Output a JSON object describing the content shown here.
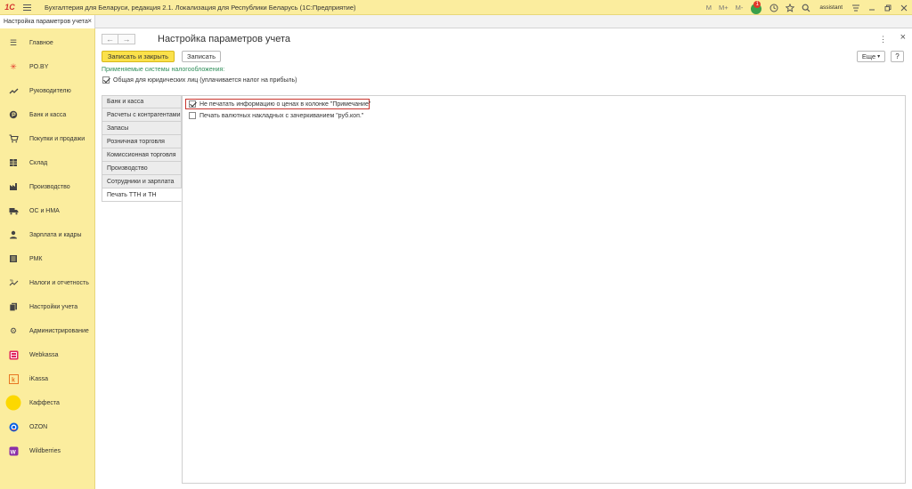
{
  "app": {
    "logo": "1С",
    "title": "Бухгалтерия для Беларуси, редакция 2.1. Локализация для Республики Беларусь  (1С:Предприятие)",
    "toolbar": {
      "m1": "M",
      "m2": "M+",
      "m3": "M-",
      "badge_count": "1",
      "user": "assistant"
    }
  },
  "tab": {
    "label": "Настройка параметров учета"
  },
  "sidebar": {
    "items": [
      {
        "label": "Главное"
      },
      {
        "label": "PO.BY"
      },
      {
        "label": "Руководителю"
      },
      {
        "label": "Банк и касса"
      },
      {
        "label": "Покупки и продажи"
      },
      {
        "label": "Склад"
      },
      {
        "label": "Производство"
      },
      {
        "label": "ОС и НМА"
      },
      {
        "label": "Зарплата и кадры"
      },
      {
        "label": "РМК"
      },
      {
        "label": "Налоги и отчетность"
      },
      {
        "label": "Настройки учета"
      },
      {
        "label": "Администрирование"
      },
      {
        "label": "Webkassa"
      },
      {
        "label": "iKassa"
      },
      {
        "label": "Каффеста"
      },
      {
        "label": "OZON"
      },
      {
        "label": "Wildberries"
      }
    ]
  },
  "form": {
    "title": "Настройка параметров учета",
    "save_close_label": "Записать и закрыть",
    "save_label": "Записать",
    "more_label": "Еще",
    "help_label": "?",
    "tax_systems_label": "Применяемые системы налогообложения:",
    "general_tax_label": "Общая для юридических лиц (уплачивается налог на прибыль)",
    "sections": [
      {
        "label": "Банк и касса"
      },
      {
        "label": "Расчеты с контрагентами"
      },
      {
        "label": "Запасы"
      },
      {
        "label": "Розничная торговля"
      },
      {
        "label": "Комиссионная торговля"
      },
      {
        "label": "Производство"
      },
      {
        "label": "Сотрудники и зарплата"
      },
      {
        "label": "Печать ТТН и ТН"
      }
    ],
    "options": {
      "no_price_note": "Не печатать информацию о ценах в колонке \"Примечание\"",
      "currency_strike": "Печать валютных накладных с зачеркиванием \"руб.коп.\""
    }
  }
}
